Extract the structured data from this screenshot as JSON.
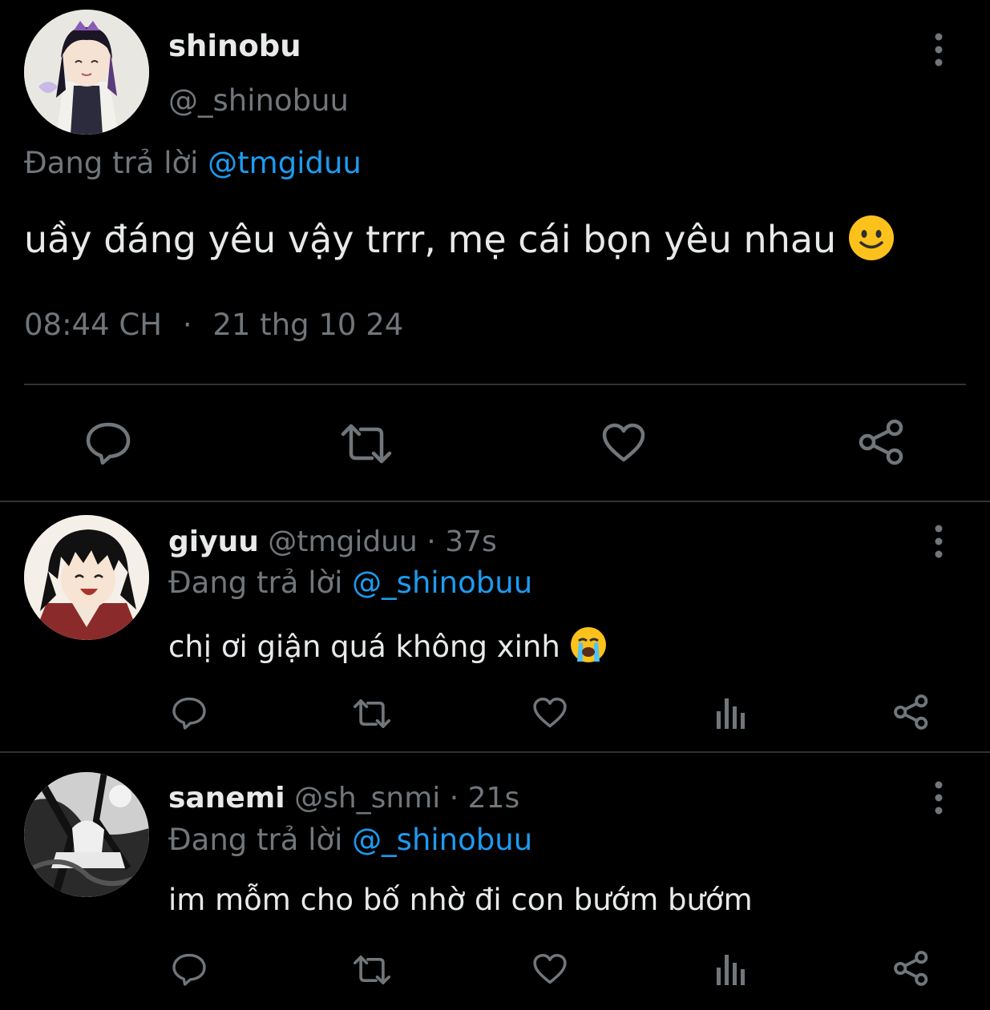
{
  "main_tweet": {
    "display_name": "shinobu",
    "handle": "@_shinobuu",
    "reply_prefix": "Đang trả lời",
    "reply_to": "@tmgiduu",
    "text": "uầy đáng yêu vậy trrr, mẹ cái bọn yêu nhau",
    "emoji": "slightly-smiling-face",
    "time": "08:44 CH",
    "separator": "·",
    "date": "21 thg 10 24"
  },
  "replies": [
    {
      "display_name": "giyuu",
      "handle": "@tmgiduu",
      "dot": "·",
      "age": "37s",
      "reply_prefix": "Đang trả lời",
      "reply_to": "@_shinobuu",
      "text": "chị ơi giận quá không xinh",
      "emoji": "loudly-crying-face"
    },
    {
      "display_name": "sanemi",
      "handle": "@sh_snmi",
      "dot": "·",
      "age": "21s",
      "reply_prefix": "Đang trả lời",
      "reply_to": "@_shinobuu",
      "text": "im mỗm cho bố nhờ đi con bướm bướm"
    }
  ],
  "colors": {
    "background": "#000000",
    "text": "#e7e9ea",
    "muted": "#71767b",
    "link": "#1d9bf0",
    "divider": "#2f3336"
  }
}
